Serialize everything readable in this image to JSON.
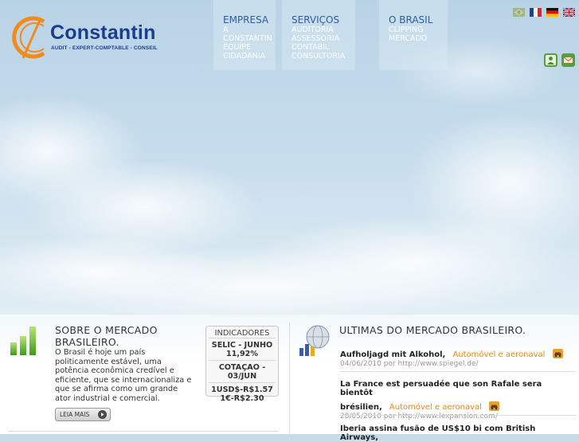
{
  "brand": {
    "name": "Constantin",
    "tagline": "AUDIT - EXPERT-COMPTABLE - CONSEIL"
  },
  "nav": [
    {
      "label": "EMPRESA",
      "items": [
        "A",
        "CONSTANTIN",
        "EQUIPE",
        "CIDADANIA"
      ]
    },
    {
      "label": "SERVIÇOS",
      "items": [
        "AUDITORIA",
        "ASSESSORIA",
        "CONTÁBIL",
        "CONSULTORIA"
      ]
    },
    {
      "label": "O BRASIL",
      "items": [
        "CLIPPING",
        "MERCADO"
      ]
    }
  ],
  "languages": [
    "Português",
    "Français",
    "Deutsch",
    "English"
  ],
  "utility_icons": [
    "contact-person-icon",
    "email-icon"
  ],
  "about": {
    "title_line1": "SOBRE O MERCADO",
    "title_line2": "BRASILEIRO.",
    "text_lines": [
      "O Brasil é hoje um país",
      "politicamente estável, uma",
      "potência econômica credível e",
      "eficiente, que se internacionaliza e",
      "que se afirma como um grande",
      "ator industrial e comercial."
    ],
    "read_more": "LEIA MAIS"
  },
  "indicators": {
    "heading": "INDICADORES",
    "rows": [
      {
        "l1": "SELIC - JUNHO",
        "l2": "11,92%"
      },
      {
        "l1": "COTAÇAO -",
        "l2": "03/JUN"
      },
      {
        "l1": "1USD$-R$1.57",
        "l2": "1€-R$2.30"
      }
    ]
  },
  "news": {
    "title": "ULTIMAS DO MERCADO BRASILEIRO.",
    "items": [
      {
        "headline": "Aufholjagd mit Alkohol,",
        "headline2": "",
        "category": "Automóvel e aeronaval",
        "meta": "04/06/2010 por http://www.spiegel.de/"
      },
      {
        "headline": "La France est persuadée que son Rafale sera bientôt",
        "headline2": "brésilien,",
        "category": "Automóvel e aeronaval",
        "meta": "28/05/2010 por http://www.lexpansion.com/"
      },
      {
        "headline": "Iberia assina fusão de US$10 bi com British Airways,",
        "headline2": "",
        "category": "",
        "meta": ""
      }
    ]
  },
  "colors": {
    "brand_blue": "#1a3e8c",
    "logo_orange": "#f08c1e",
    "nav_blue": "#2c5e9c",
    "news_category": "#e08a17"
  }
}
